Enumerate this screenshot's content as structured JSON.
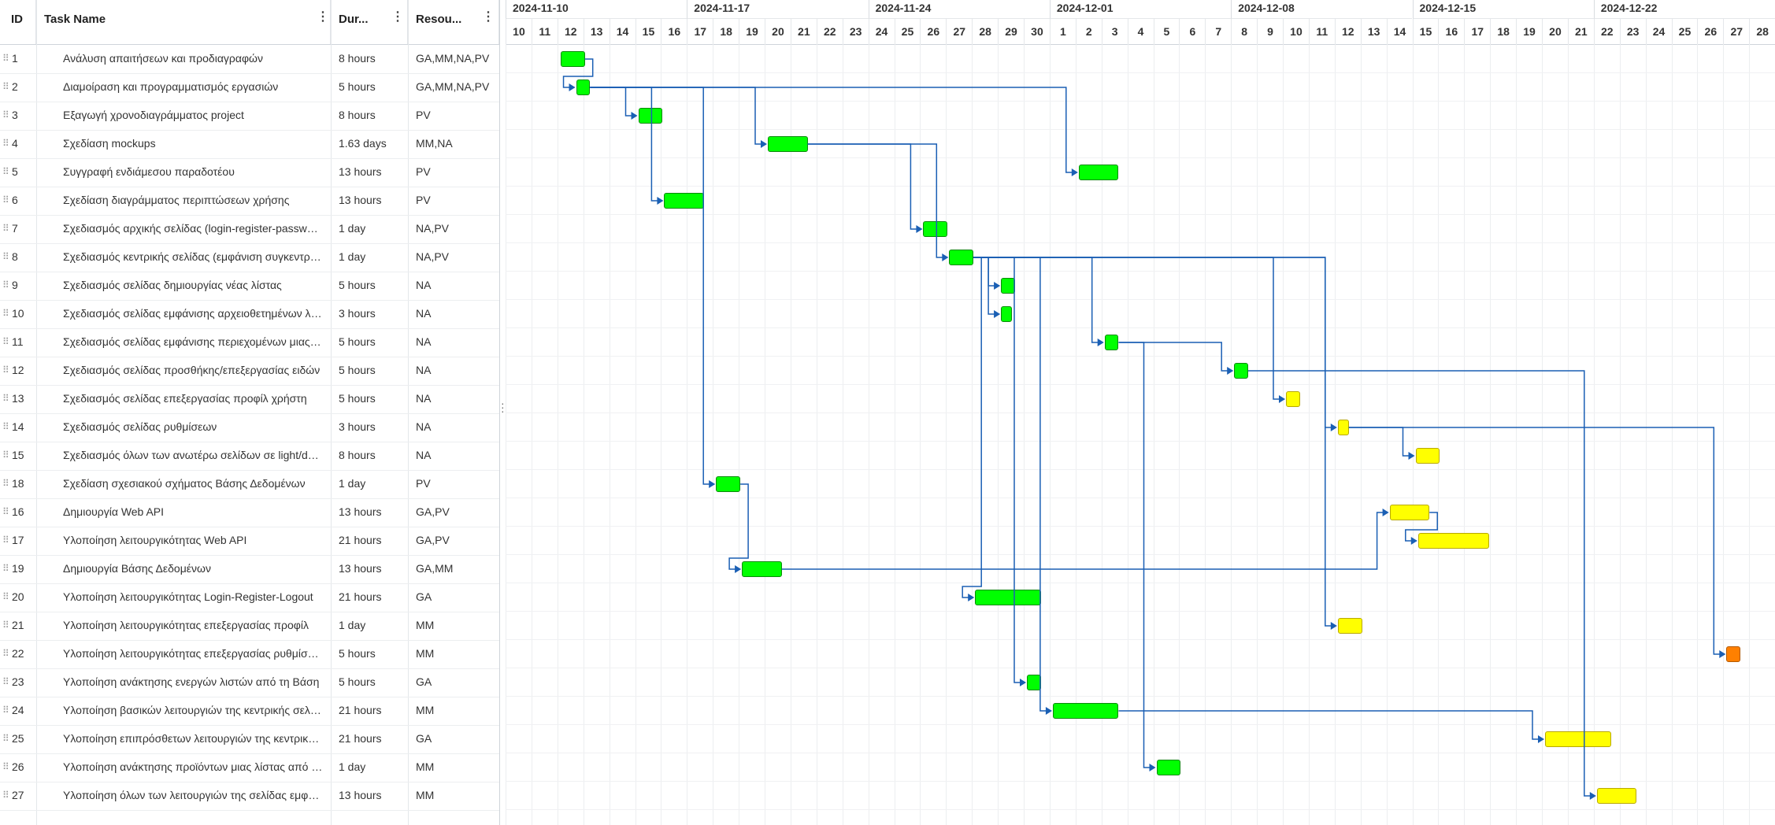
{
  "columns": {
    "id": "ID",
    "name": "Task Name",
    "duration": "Dur...",
    "resources": "Resou..."
  },
  "weeks": [
    "2024-11-10",
    "2024-11-17",
    "2024-11-24",
    "2024-12-01",
    "2024-12-08",
    "2024-12-15",
    "2024-12-22"
  ],
  "days": [
    "10",
    "11",
    "12",
    "13",
    "14",
    "15",
    "16",
    "17",
    "18",
    "19",
    "20",
    "21",
    "22",
    "23",
    "24",
    "25",
    "26",
    "27",
    "28",
    "29",
    "30",
    "1",
    "2",
    "3",
    "4",
    "5",
    "6",
    "7",
    "8",
    "9",
    "10",
    "11",
    "12",
    "13",
    "14",
    "15",
    "16",
    "17",
    "18",
    "19",
    "20",
    "21",
    "22",
    "23",
    "24",
    "25",
    "26",
    "27",
    "28"
  ],
  "colors": {
    "done": "#00ff00",
    "progress": "#ffff00",
    "late": "#ff8000",
    "link": "#1a5fb4"
  },
  "tasks": [
    {
      "id": "1",
      "name": "Ανάλυση απαιτήσεων και προδιαγραφών",
      "duration": "8 hours",
      "resources": "GA,MM,NA,PV",
      "status": "done",
      "start": 2,
      "len": 1
    },
    {
      "id": "2",
      "name": "Διαμοίραση και προγραμματισμός εργασιών",
      "duration": "5 hours",
      "resources": "GA,MM,NA,PV",
      "status": "done",
      "start": 2.6,
      "len": 0.6
    },
    {
      "id": "3",
      "name": "Εξαγωγή χρονοδιαγράμματος project",
      "duration": "8 hours",
      "resources": "PV",
      "status": "done",
      "start": 5,
      "len": 1
    },
    {
      "id": "4",
      "name": "Σχεδίαση mockups",
      "duration": "1.63 days",
      "resources": "MM,NA",
      "status": "done",
      "start": 10,
      "len": 1.6
    },
    {
      "id": "5",
      "name": "Συγγραφή ενδιάμεσου παραδοτέου",
      "duration": "13 hours",
      "resources": "PV",
      "status": "done",
      "start": 22,
      "len": 1.6
    },
    {
      "id": "6",
      "name": "Σχεδίαση διαγράμματος περιπτώσεων χρήσης",
      "duration": "13 hours",
      "resources": "PV",
      "status": "done",
      "start": 6,
      "len": 1.6
    },
    {
      "id": "7",
      "name": "Σχεδιασμός αρχικής σελίδας (login-register-password reset)",
      "duration": "1 day",
      "resources": "NA,PV",
      "status": "done",
      "start": 16,
      "len": 1
    },
    {
      "id": "8",
      "name": "Σχεδιασμός κεντρικής σελίδας (εμφάνιση συγκεντρωτικών λιστών)",
      "duration": "1 day",
      "resources": "NA,PV",
      "status": "done",
      "start": 17,
      "len": 1
    },
    {
      "id": "9",
      "name": "Σχεδιασμός σελίδας δημιουργίας νέας λίστας",
      "duration": "5 hours",
      "resources": "NA",
      "status": "done",
      "start": 19,
      "len": 0.6
    },
    {
      "id": "10",
      "name": "Σχεδιασμός σελίδας εμφάνισης αρχειοθετημένων λιστών",
      "duration": "3 hours",
      "resources": "NA",
      "status": "done",
      "start": 19,
      "len": 0.45
    },
    {
      "id": "11",
      "name": "Σχεδιασμός σελίδας εμφάνισης περιεχομένων μιας λίστας",
      "duration": "5 hours",
      "resources": "NA",
      "status": "done",
      "start": 23,
      "len": 0.6
    },
    {
      "id": "12",
      "name": "Σχεδιασμός σελίδας προσθήκης/επεξεργασίας ειδών",
      "duration": "5 hours",
      "resources": "NA",
      "status": "done",
      "start": 28,
      "len": 0.6
    },
    {
      "id": "13",
      "name": "Σχεδιασμός σελίδας επεξεργασίας προφίλ χρήστη",
      "duration": "5 hours",
      "resources": "NA",
      "status": "progress",
      "start": 30,
      "len": 0.6
    },
    {
      "id": "14",
      "name": "Σχεδιασμός σελίδας ρυθμίσεων",
      "duration": "3 hours",
      "resources": "NA",
      "status": "progress",
      "start": 32,
      "len": 0.45
    },
    {
      "id": "15",
      "name": "Σχεδιασμός όλων των ανωτέρω σελίδων σε light/dark mode",
      "duration": "8 hours",
      "resources": "NA",
      "status": "progress",
      "start": 35,
      "len": 1
    },
    {
      "id": "18",
      "name": "Σχεδίαση σχεσιακού σχήματος Βάσης Δεδομένων",
      "duration": "1 day",
      "resources": "PV",
      "status": "done",
      "start": 8,
      "len": 1
    },
    {
      "id": "16",
      "name": "Δημιουργία Web API",
      "duration": "13 hours",
      "resources": "GA,PV",
      "status": "progress",
      "start": 34,
      "len": 1.6
    },
    {
      "id": "17",
      "name": "Υλοποίηση λειτουργικότητας Web API",
      "duration": "21 hours",
      "resources": "GA,PV",
      "status": "progress",
      "start": 35.1,
      "len": 2.8
    },
    {
      "id": "19",
      "name": "Δημιουργία Βάσης Δεδομένων",
      "duration": "13 hours",
      "resources": "GA,MM",
      "status": "done",
      "start": 9,
      "len": 1.6
    },
    {
      "id": "20",
      "name": "Υλοποίηση λειτουργικότητας Login-Register-Logout",
      "duration": "21 hours",
      "resources": "GA",
      "status": "done",
      "start": 18,
      "len": 2.6
    },
    {
      "id": "21",
      "name": "Υλοποίηση λειτουργικότητας επεξεργασίας προφίλ",
      "duration": "1 day",
      "resources": "MM",
      "status": "progress",
      "start": 32,
      "len": 1
    },
    {
      "id": "22",
      "name": "Υλοποίηση λειτουργικότητας επεξεργασίας ρυθμίσεων",
      "duration": "5 hours",
      "resources": "MM",
      "status": "late",
      "start": 47,
      "len": 0.6
    },
    {
      "id": "23",
      "name": "Υλοποίηση ανάκτησης ενεργών λιστών από τη Βάση",
      "duration": "5 hours",
      "resources": "GA",
      "status": "done",
      "start": 20,
      "len": 0.6
    },
    {
      "id": "24",
      "name": "Υλοποίηση βασικών λειτουργιών της κεντρικής σελίδας",
      "duration": "21 hours",
      "resources": "MM",
      "status": "done",
      "start": 21,
      "len": 2.6
    },
    {
      "id": "25",
      "name": "Υλοποίηση επιπρόσθετων λειτουργιών της κεντρικής σελίδας",
      "duration": "21 hours",
      "resources": "GA",
      "status": "progress",
      "start": 40,
      "len": 2.6
    },
    {
      "id": "26",
      "name": "Υλοποίηση ανάκτησης προϊόντων μιας λίστας από τη Βάση",
      "duration": "1 day",
      "resources": "MM",
      "status": "done",
      "start": 25,
      "len": 1
    },
    {
      "id": "27",
      "name": "Υλοποίηση όλων των λειτουργιών της σελίδας εμφάνισης λίστας",
      "duration": "13 hours",
      "resources": "MM",
      "status": "progress",
      "start": 42,
      "len": 1.6
    }
  ]
}
